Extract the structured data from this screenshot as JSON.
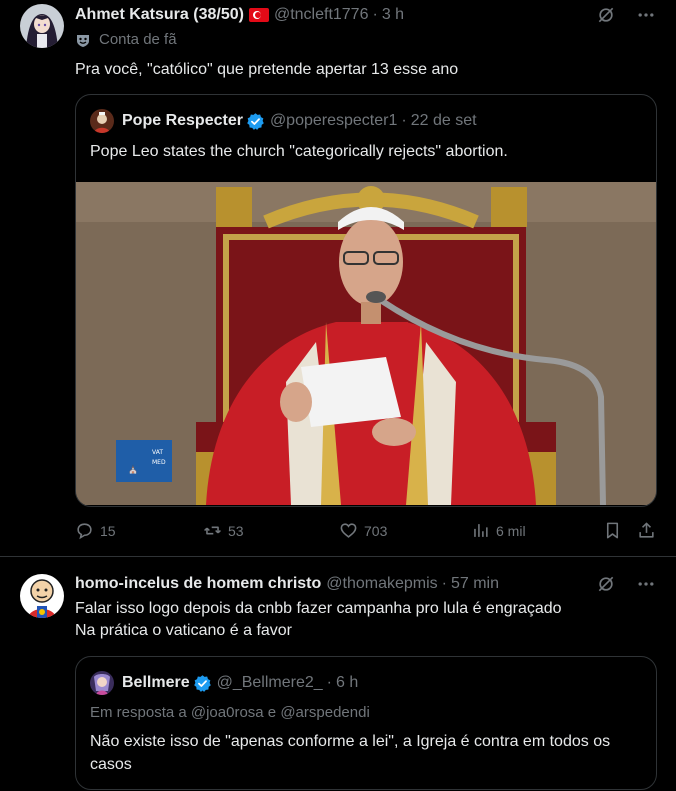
{
  "post1": {
    "author_name": "Ahmet Katsura (38/50)",
    "author_handle": "@tncleft1776",
    "time": "3 h",
    "badge_text": "Conta de fã",
    "text": "Pra você, \"católico\" que pretende apertar 13 esse ano",
    "quote": {
      "author_name": "Pope Respecter",
      "author_handle": "@poperespecter1",
      "time": "22 de set",
      "text": "Pope Leo states the church \"categorically rejects\" abortion.",
      "media_watermark": "VATICAN MEDIA"
    },
    "actions": {
      "replies": "15",
      "reposts": "53",
      "likes": "703",
      "views": "6 mil"
    }
  },
  "post2": {
    "author_name": "homo-incelus de homem christo",
    "author_handle": "@thomakepmis",
    "time": "57 min",
    "text_line1": "Falar isso logo depois da cnbb fazer campanha pro lula é engraçado",
    "text_line2": "Na prática o vaticano é a favor",
    "quote": {
      "author_name": "Bellmere",
      "author_handle": "@_Bellmere2_",
      "time": "6 h",
      "reply_to": "Em resposta a @joa0rosa e @arspedendi",
      "text": "Não existe isso de \"apenas conforme a lei\", a Igreja é contra em todos os casos"
    }
  },
  "separator": "·",
  "colors": {
    "background": "#000000",
    "text": "#e7e9ea",
    "muted": "#71767b",
    "border": "#2f3336",
    "verified": "#1d9bf0"
  },
  "icons": [
    "grok-icon",
    "more-icon",
    "reply-icon",
    "repost-icon",
    "like-icon",
    "views-icon",
    "bookmark-icon",
    "share-icon",
    "verified-icon",
    "fan-badge-icon"
  ]
}
